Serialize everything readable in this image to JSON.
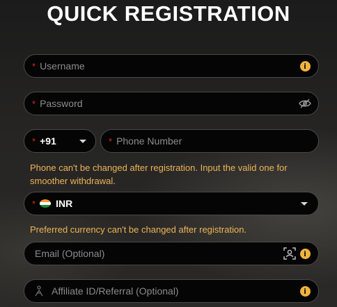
{
  "title": "QUICK REGISTRATION",
  "fields": {
    "username": {
      "placeholder": "Username",
      "required_mark": "*",
      "icon": "info-icon"
    },
    "password": {
      "placeholder": "Password",
      "required_mark": "*",
      "icon": "eye-slash-icon"
    },
    "country_code": {
      "value": "+91",
      "required_mark": "*"
    },
    "phone": {
      "placeholder": "Phone Number",
      "required_mark": "*"
    },
    "currency": {
      "value": "INR",
      "required_mark": "*",
      "flag": "india-flag-icon"
    },
    "email": {
      "placeholder": "Email (Optional)",
      "icons": [
        "contact-scan-icon",
        "info-icon"
      ]
    },
    "affiliate": {
      "placeholder": "Affiliate ID/Referral (Optional)",
      "icon_left": "affiliate-icon",
      "icon_right": "info-icon"
    }
  },
  "notes": {
    "phone": "Phone can't be changed after registration. Input the valid one for smoother withdrawal.",
    "currency": "Preferred currency can't be changed after registration."
  },
  "colors": {
    "accent": "#efb456",
    "required": "#d62828",
    "field_bg": "#050505",
    "info_icon": "#f0b43c"
  },
  "info_glyph": "i"
}
